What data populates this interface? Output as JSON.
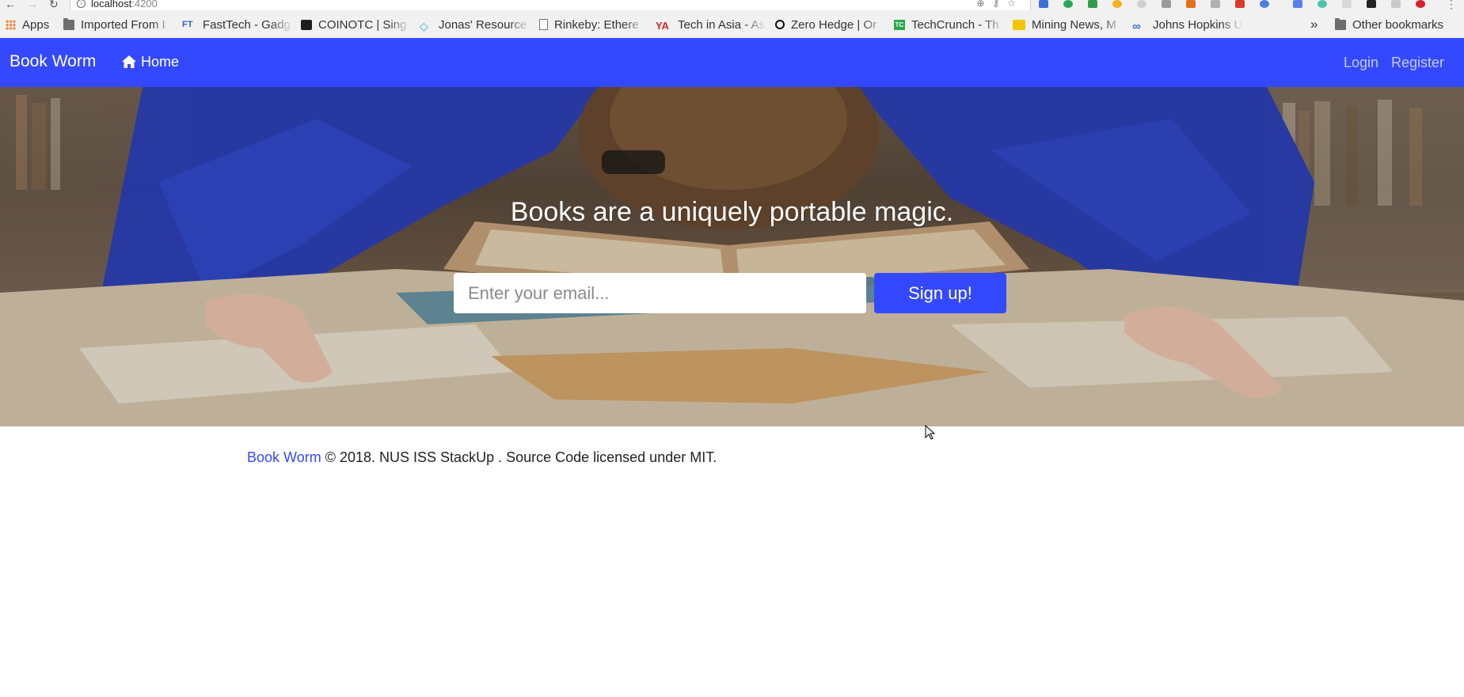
{
  "browser": {
    "url_host": "localhost",
    "url_port": ":4200",
    "bookmarks": [
      {
        "label": "Apps",
        "icon": "apps-icon"
      },
      {
        "label": "Imported From I",
        "icon": "folder-icon"
      },
      {
        "label": "FastTech - Gadg",
        "icon": "fasttech-icon"
      },
      {
        "label": "COINOTC | Sing",
        "icon": "coinotc-icon"
      },
      {
        "label": "Jonas' Resource",
        "icon": "diamond-icon"
      },
      {
        "label": "Rinkeby: Ethere",
        "icon": "page-icon"
      },
      {
        "label": "Tech in Asia - As",
        "icon": "techinasia-icon"
      },
      {
        "label": "Zero Hedge | Or",
        "icon": "zerohedge-icon"
      },
      {
        "label": "TechCrunch - Th",
        "icon": "techcrunch-icon"
      },
      {
        "label": "Mining News, M",
        "icon": "mining-icon"
      },
      {
        "label": "Johns Hopkins U",
        "icon": "link-icon"
      }
    ],
    "overflow_label": "»",
    "other_bookmarks": "Other bookmarks"
  },
  "navbar": {
    "brand": "Book Worm",
    "home_label": "Home",
    "login_label": "Login",
    "register_label": "Register",
    "color": "#3449ff"
  },
  "hero": {
    "title": "Books are a uniquely portable magic.",
    "email_placeholder": "Enter your email...",
    "signup_label": "Sign up!"
  },
  "footer": {
    "brand": "Book Worm",
    "text": "© 2018. NUS ISS StackUp . Source Code licensed under MIT."
  }
}
